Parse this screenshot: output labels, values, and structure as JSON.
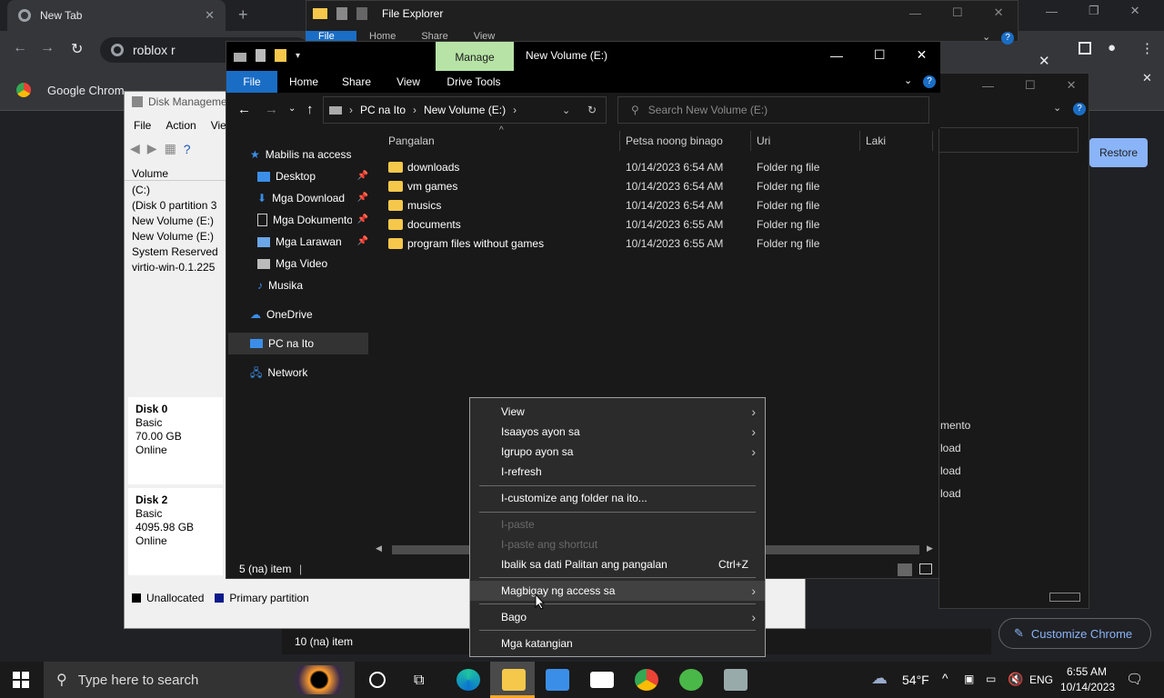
{
  "chrome": {
    "tab_title": "New Tab",
    "omnibox_text": "roblox r",
    "bookmark_label": "Google Chrom",
    "restore_label": "Restore",
    "customize_label": "Customize Chrome"
  },
  "explorer_back": {
    "title": "File Explorer",
    "tabs": [
      "File",
      "Home",
      "Share",
      "View"
    ]
  },
  "win3": {
    "items": [
      "mento",
      "load",
      "load",
      "load"
    ]
  },
  "disk_mgmt": {
    "title": "Disk Manageme",
    "menu": [
      "File",
      "Action",
      "Vie"
    ],
    "volume_header": "Volume",
    "volumes": [
      "(C:)",
      "(Disk 0 partition 3",
      "New Volume (E:)",
      "New Volume (E:)",
      "System Reserved",
      "virtio-win-0.1.225"
    ],
    "disks": [
      {
        "name": "Disk 0",
        "type": "Basic",
        "size": "70.00 GB",
        "status": "Online"
      },
      {
        "name": "Disk 2",
        "type": "Basic",
        "size": "4095.98 GB",
        "status": "Online"
      }
    ],
    "legend_unallocated": "Unallocated",
    "legend_primary": "Primary partition"
  },
  "explorer": {
    "title": "New Volume (E:)",
    "manage_tab": "Manage",
    "ribbon_tabs": [
      "File",
      "Home",
      "Share",
      "View",
      "Drive Tools"
    ],
    "breadcrumb": [
      "PC na Ito",
      "New Volume (E:)"
    ],
    "search_placeholder": "Search New Volume (E:)",
    "nav": {
      "quick_access": "Mabilis na access",
      "quick_items": [
        "Desktop",
        "Mga Download",
        "Mga Dokumento",
        "Mga Larawan",
        "Mga Video",
        "Musika"
      ],
      "onedrive": "OneDrive",
      "this_pc": "PC na Ito",
      "network": "Network"
    },
    "columns": [
      "Pangalan",
      "Petsa noong binago",
      "Uri",
      "Laki"
    ],
    "files": [
      {
        "name": "downloads",
        "date": "10/14/2023 6:54 AM",
        "type": "Folder ng file"
      },
      {
        "name": "vm games",
        "date": "10/14/2023 6:54 AM",
        "type": "Folder ng file"
      },
      {
        "name": "musics",
        "date": "10/14/2023 6:54 AM",
        "type": "Folder ng file"
      },
      {
        "name": "documents",
        "date": "10/14/2023 6:55 AM",
        "type": "Folder ng file"
      },
      {
        "name": "program files without games",
        "date": "10/14/2023 6:55 AM",
        "type": "Folder ng file"
      }
    ],
    "status_count": "5 (na) item",
    "back_status_count": "10 (na) item"
  },
  "context_menu": {
    "view": "View",
    "sort": "Isaayos ayon sa",
    "group": "Igrupo ayon sa",
    "refresh": "I-refresh",
    "customize": "I-customize ang folder na ito...",
    "paste": "I-paste",
    "paste_shortcut": "I-paste ang shortcut",
    "undo": "Ibalik sa dati Palitan ang pangalan",
    "undo_shortcut": "Ctrl+Z",
    "give_access": "Magbigay ng access sa",
    "new": "Bago",
    "properties": "Mga katangian"
  },
  "taskbar": {
    "search_placeholder": "Type here to search",
    "weather": "54°F",
    "language": "ENG",
    "time": "6:55 AM",
    "date": "10/14/2023"
  }
}
